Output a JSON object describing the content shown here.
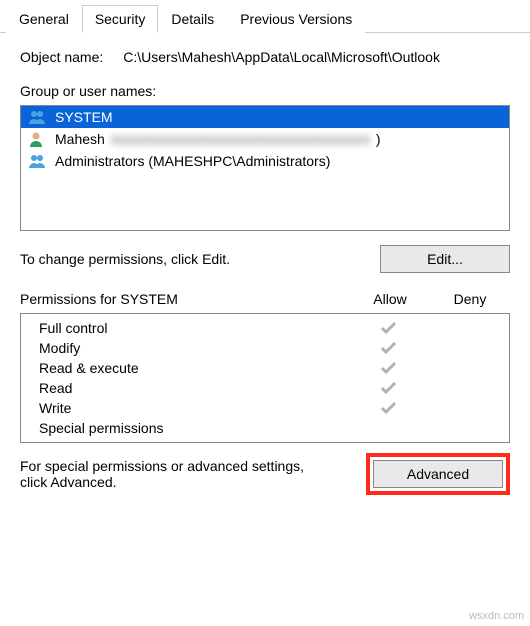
{
  "tabs": {
    "general": "General",
    "security": "Security",
    "details": "Details",
    "previous": "Previous Versions",
    "active": "security"
  },
  "object": {
    "label": "Object name:",
    "value": "C:\\Users\\Mahesh\\AppData\\Local\\Microsoft\\Outlook"
  },
  "groups": {
    "label": "Group or user names:",
    "items": [
      {
        "name": "SYSTEM",
        "type": "group",
        "selected": true
      },
      {
        "name": "Mahesh",
        "suffix_hidden": "xxxxxxxxxxxxxxxxxxxxxxxxxxxxxxxxxxxxx",
        "close": ")",
        "type": "user",
        "selected": false
      },
      {
        "name": "Administrators (MAHESHPC\\Administrators)",
        "type": "group",
        "selected": false
      }
    ]
  },
  "edit": {
    "text": "To change permissions, click Edit.",
    "button": "Edit..."
  },
  "perm": {
    "title": "Permissions for SYSTEM",
    "allow": "Allow",
    "deny": "Deny",
    "rows": [
      {
        "name": "Full control",
        "allow": true,
        "deny": false
      },
      {
        "name": "Modify",
        "allow": true,
        "deny": false
      },
      {
        "name": "Read & execute",
        "allow": true,
        "deny": false
      },
      {
        "name": "Read",
        "allow": true,
        "deny": false
      },
      {
        "name": "Write",
        "allow": true,
        "deny": false
      },
      {
        "name": "Special permissions",
        "allow": false,
        "deny": false
      }
    ]
  },
  "advanced": {
    "text": "For special permissions or advanced settings, click Advanced.",
    "button": "Advanced"
  },
  "watermark": "wsxdn.com"
}
